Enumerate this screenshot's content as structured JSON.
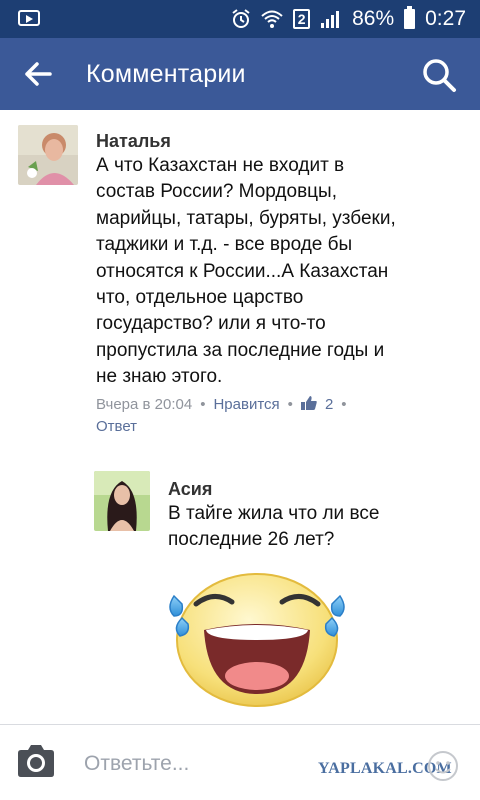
{
  "status_bar": {
    "sim_number": "2",
    "battery_percent": "86%",
    "time": "0:27"
  },
  "app_bar": {
    "title": "Комментарии",
    "back_icon": "arrow-left-icon",
    "search_icon": "search-icon",
    "background": "#3b5998"
  },
  "comments": [
    {
      "author": "Наталья",
      "text_lines": [
        "А что Казахстан не входит в",
        "состав России? Мордовцы,",
        "марийцы, татары, буряты, узбеки,",
        "таджики и т.д. - все вроде бы",
        "относятся к России...А Казахстан",
        "что, отдельное царство",
        "государство? или я что-то",
        "пропустила за последние годы и",
        "не знаю этого."
      ],
      "time": "Вчера в 20:04",
      "like_label": "Нравится",
      "like_count": "2",
      "reply_label": "Ответ"
    },
    {
      "author": "Асия",
      "text_lines": [
        "В тайге жила что ли все",
        "последние 26 лет?"
      ],
      "sticker": "laughing-face-sticker"
    }
  ],
  "reply_bar": {
    "placeholder": "Ответьте...",
    "camera_icon": "camera-icon",
    "emoji_icon": "smiley-icon"
  },
  "watermark": "YAPLAKAL.COM"
}
